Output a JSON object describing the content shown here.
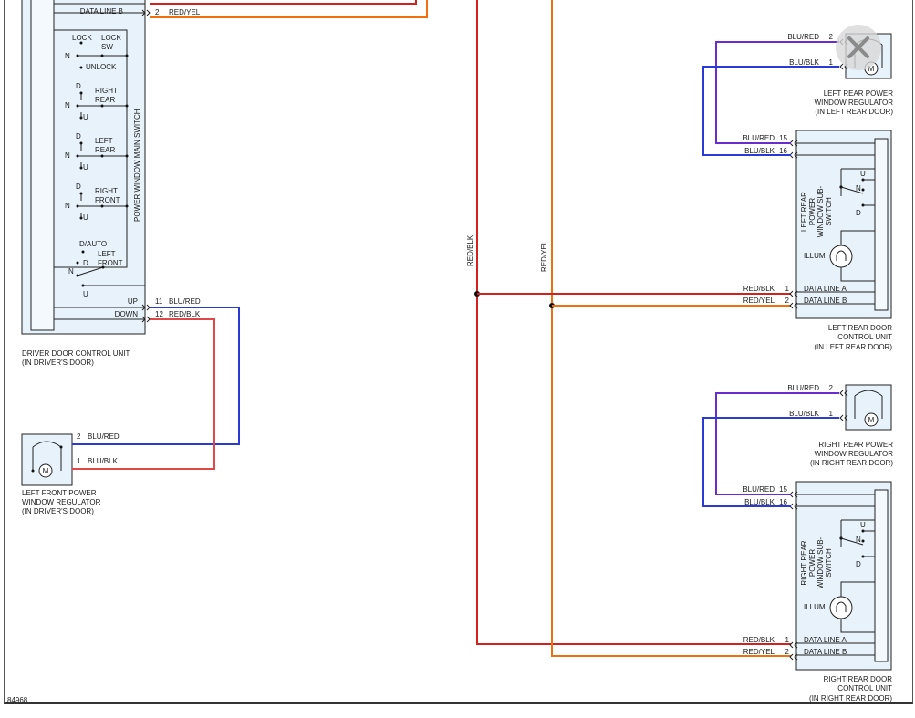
{
  "diagram_id": "84968",
  "close_label": "Close",
  "driver_unit": {
    "caption": [
      "DRIVER DOOR CONTROL UNIT",
      "(IN DRIVER'S DOOR)"
    ],
    "switch_label": "POWER WINDOW MAIN SWITCH",
    "top_pins": [
      {
        "label": "DATA LINE B",
        "pin": "2",
        "wire": "RED/YEL"
      }
    ],
    "bottom_pins": [
      {
        "label": "UP",
        "pin": "11",
        "wire": "BLU/RED"
      },
      {
        "label": "DOWN",
        "pin": "12",
        "wire": "RED/BLK"
      }
    ],
    "lock_sw": {
      "title": [
        "LOCK",
        "SW"
      ],
      "positions": [
        "LOCK",
        "N",
        "UNLOCK"
      ]
    },
    "switch_groups": [
      {
        "name": [
          "RIGHT",
          "REAR"
        ],
        "positions": [
          "D",
          "N",
          "U"
        ]
      },
      {
        "name": [
          "LEFT",
          "REAR"
        ],
        "positions": [
          "D",
          "N",
          "U"
        ]
      },
      {
        "name": [
          "RIGHT",
          "FRONT"
        ],
        "positions": [
          "D",
          "N",
          "U"
        ]
      },
      {
        "name": [
          "LEFT",
          "FRONT"
        ],
        "positions": [
          "D/AUTO",
          "D",
          "N",
          "U"
        ]
      }
    ]
  },
  "left_front_regulator": {
    "caption": [
      "LEFT FRONT POWER",
      "WINDOW REGULATOR",
      "(IN DRIVER'S DOOR)"
    ],
    "motor": "M",
    "pins": [
      {
        "pin": "2",
        "wire": "BLU/RED"
      },
      {
        "pin": "1",
        "wire": "BLU/BLK"
      }
    ]
  },
  "bus_wires": [
    {
      "wire": "RED/BLK",
      "color": "#d62020"
    },
    {
      "wire": "RED/YEL",
      "color": "#f07010"
    }
  ],
  "rear_modules": [
    {
      "regulator": {
        "caption": [
          "LEFT REAR POWER",
          "WINDOW REGULATOR",
          "(IN LEFT REAR DOOR)"
        ],
        "motor": "M",
        "pins": [
          {
            "pin": "2",
            "wire": "BLU/RED"
          },
          {
            "pin": "1",
            "wire": "BLU/BLK"
          }
        ]
      },
      "unit": {
        "caption": [
          "LEFT REAR DOOR",
          "CONTROL UNIT",
          "(IN LEFT REAR DOOR)"
        ],
        "switch_label": [
          "LEFT REAR",
          "POWER",
          "WINDOW SUB-",
          "SWITCH"
        ],
        "switch_positions": [
          "U",
          "N",
          "D"
        ],
        "illum": "ILLUM",
        "top_pins": [
          {
            "pin": "15",
            "wire": "BLU/RED"
          },
          {
            "pin": "16",
            "wire": "BLU/BLK"
          }
        ],
        "data_pins": [
          {
            "pin": "1",
            "wire": "RED/BLK",
            "label": "DATA LINE A"
          },
          {
            "pin": "2",
            "wire": "RED/YEL",
            "label": "DATA LINE B"
          }
        ]
      }
    },
    {
      "regulator": {
        "caption": [
          "RIGHT REAR POWER",
          "WINDOW REGULATOR",
          "(IN RIGHT REAR DOOR)"
        ],
        "motor": "M",
        "pins": [
          {
            "pin": "2",
            "wire": "BLU/RED"
          },
          {
            "pin": "1",
            "wire": "BLU/BLK"
          }
        ]
      },
      "unit": {
        "caption": [
          "RIGHT REAR DOOR",
          "CONTROL UNIT",
          "(IN RIGHT REAR DOOR)"
        ],
        "switch_label": [
          "RIGHT REAR",
          "POWER",
          "WINDOW SUB-",
          "SWITCH"
        ],
        "switch_positions": [
          "U",
          "N",
          "D"
        ],
        "illum": "ILLUM",
        "top_pins": [
          {
            "pin": "15",
            "wire": "BLU/RED"
          },
          {
            "pin": "16",
            "wire": "BLU/BLK"
          }
        ],
        "data_pins": [
          {
            "pin": "1",
            "wire": "RED/BLK",
            "label": "DATA LINE A"
          },
          {
            "pin": "2",
            "wire": "RED/YEL",
            "label": "DATA LINE B"
          }
        ]
      }
    }
  ],
  "colors": {
    "blu_red": "#6a2ccf",
    "blu_blk": "#2a3ad8",
    "red_blk": "#d62020",
    "red_yel": "#f07010",
    "red_blk_lf": "#e04848",
    "component_fill": "#e8f2fa",
    "line": "#222222"
  }
}
